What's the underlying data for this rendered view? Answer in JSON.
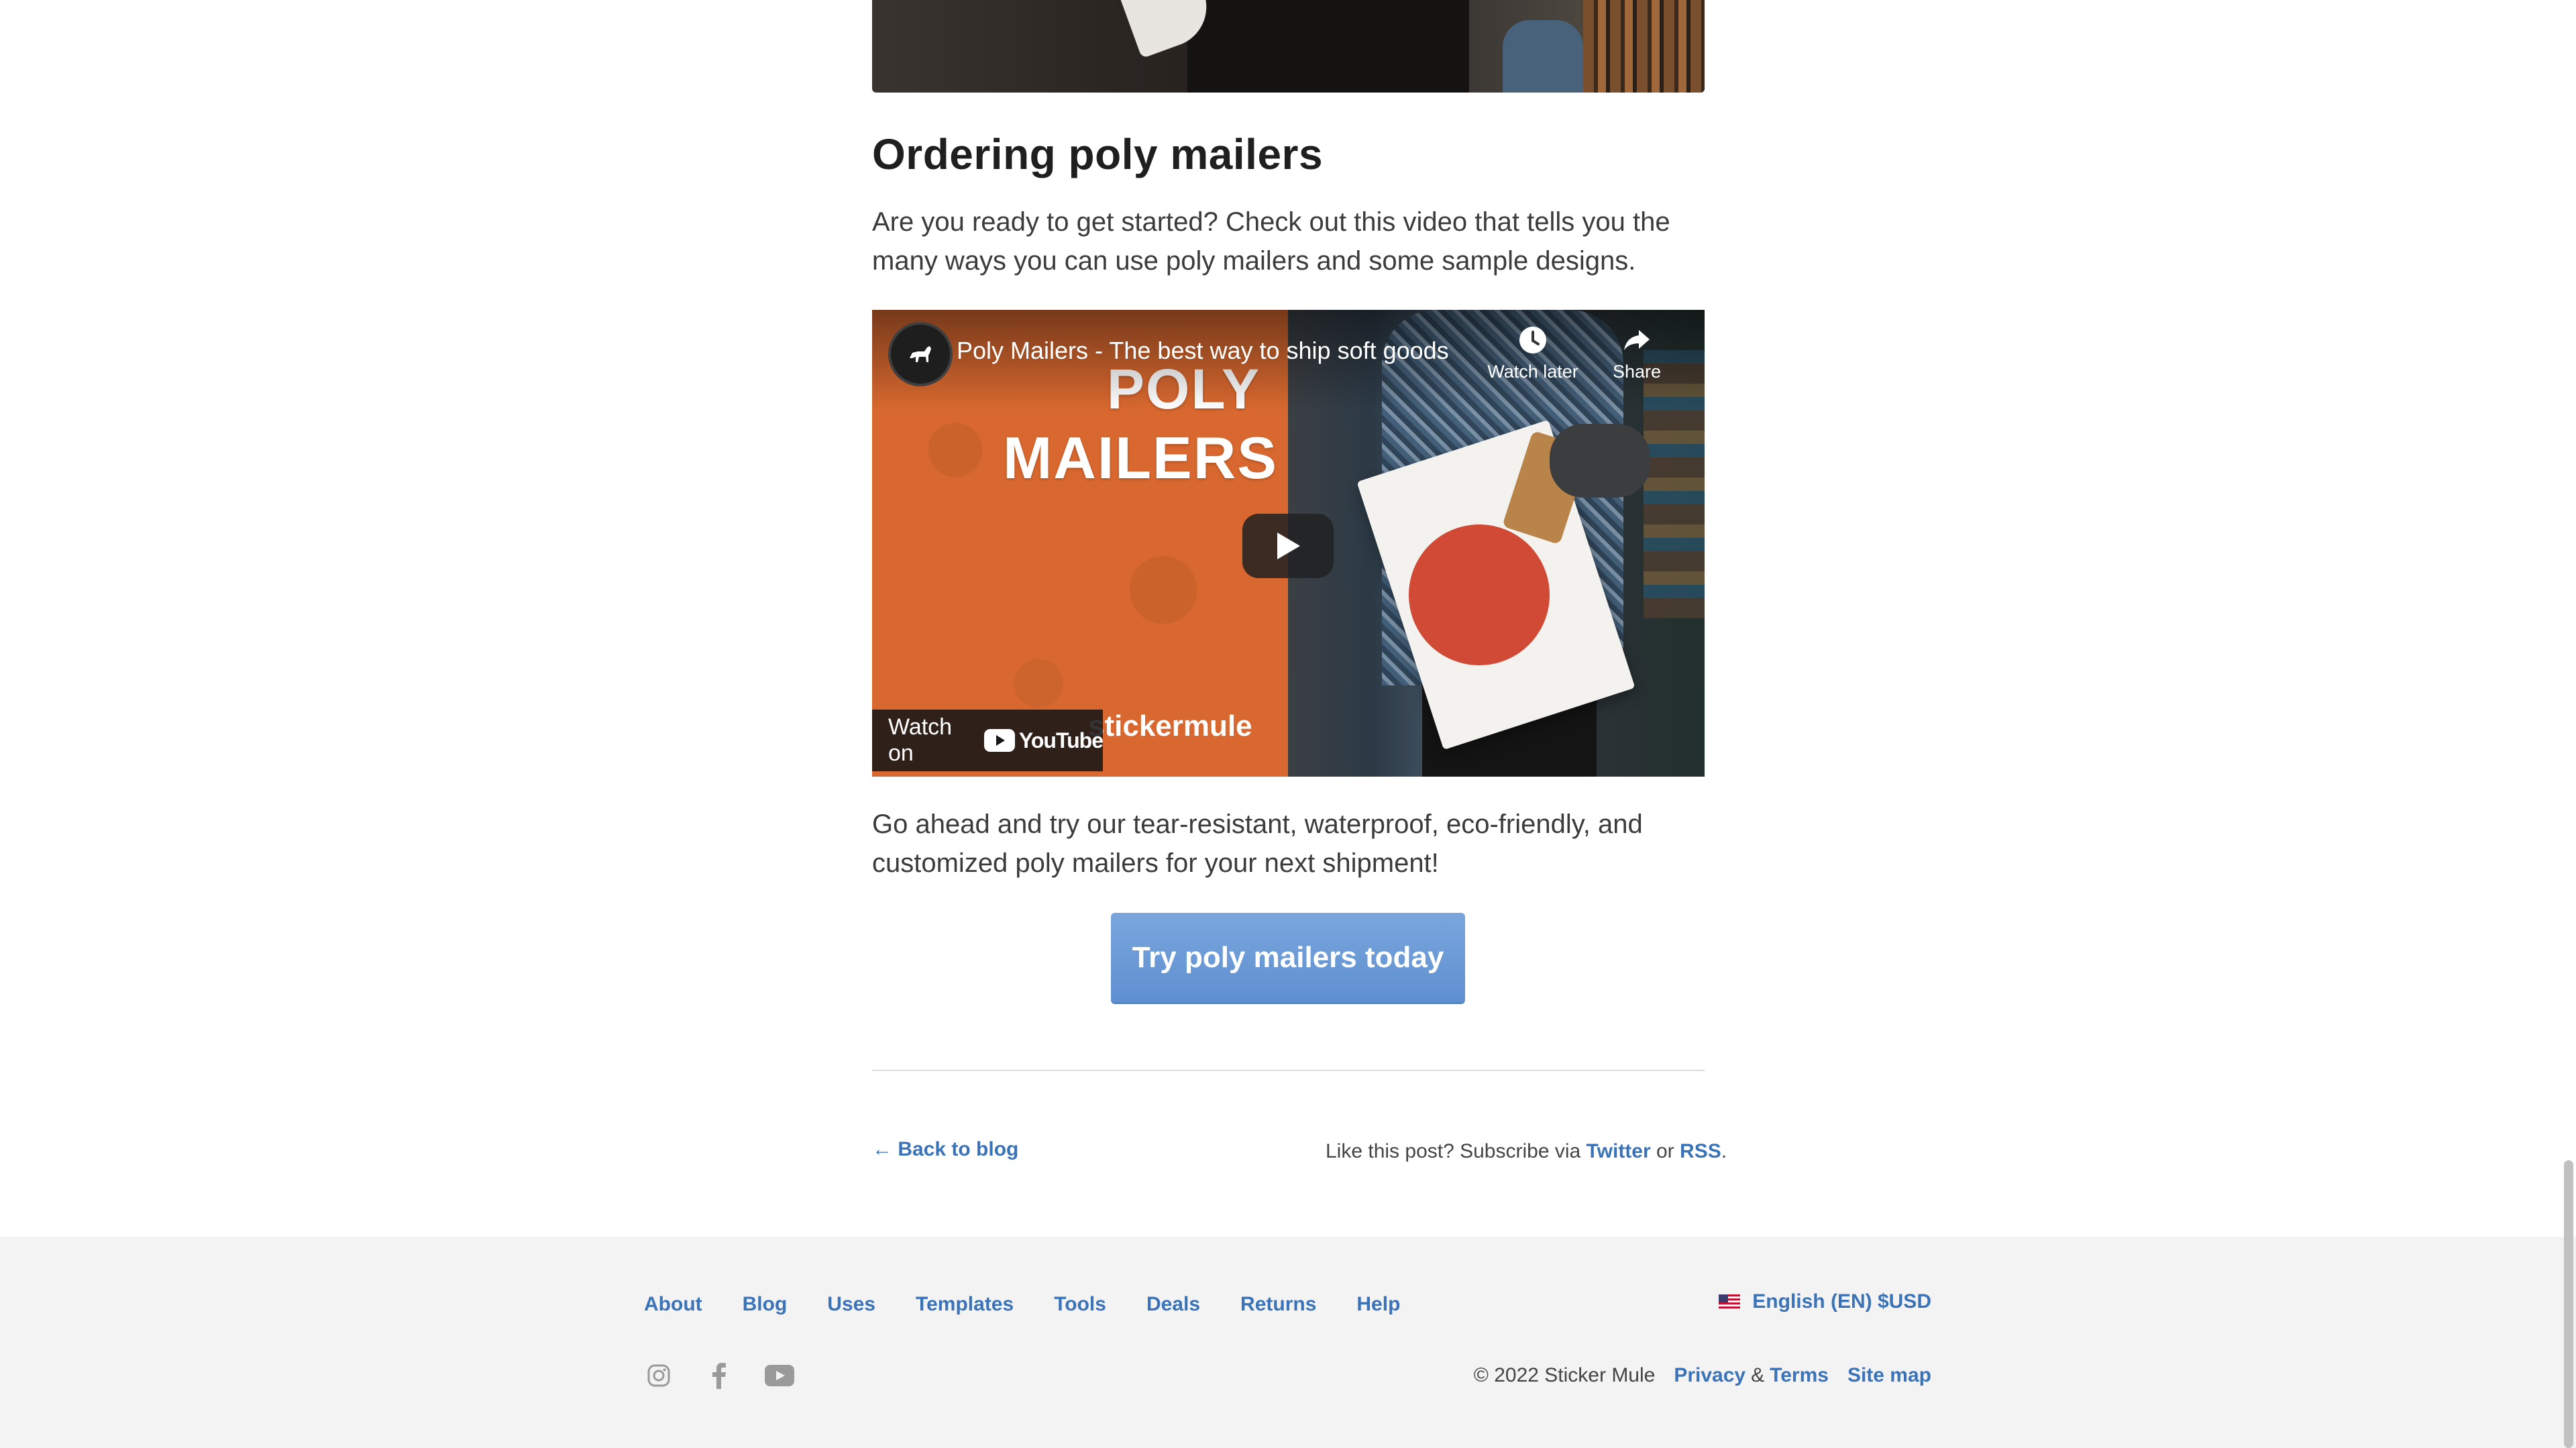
{
  "article": {
    "section_title": "Ordering poly mailers",
    "intro_paragraph": "Are you ready to get started? Check out this video that tells you the many ways you can use poly mailers and some sample designs.",
    "closing_paragraph": "Go ahead and try our tear-resistant, waterproof, eco-friendly, and customized poly mailers for your next shipment!",
    "cta_label": "Try poly mailers today"
  },
  "video": {
    "title": "Poly Mailers - The best way to ship soft goods",
    "thumbnail_text_line1": "POLY",
    "thumbnail_text_line2": "MAILERS",
    "thumbnail_brand": "stickermule",
    "watch_later_label": "Watch later",
    "share_label": "Share",
    "watch_on_label": "Watch on",
    "youtube_wordmark": "YouTube",
    "channel_icon": "goat-icon",
    "play_icon": "play-icon"
  },
  "post_footer": {
    "back_label": "← Back to blog",
    "subscribe_prefix": "Like this post? Subscribe via",
    "twitter_label": "Twitter",
    "or_label": "or",
    "rss_label": "RSS",
    "period": "."
  },
  "footer": {
    "nav": [
      "About",
      "Blog",
      "Uses",
      "Templates",
      "Tools",
      "Deals",
      "Returns",
      "Help"
    ],
    "locale_label": "English (EN) $USD",
    "social_icons": [
      "instagram-icon",
      "facebook-icon",
      "youtube-icon"
    ],
    "copyright": "© 2022 Sticker Mule",
    "privacy_label": "Privacy",
    "amp": "&",
    "terms_label": "Terms",
    "site_map_label": "Site map"
  },
  "colors": {
    "link": "#3b73b9",
    "cta_top": "#7aa6dd",
    "cta_bottom": "#5e8fd0",
    "footer_bg": "#f3f3f3",
    "video_orange": "#d8682f"
  }
}
